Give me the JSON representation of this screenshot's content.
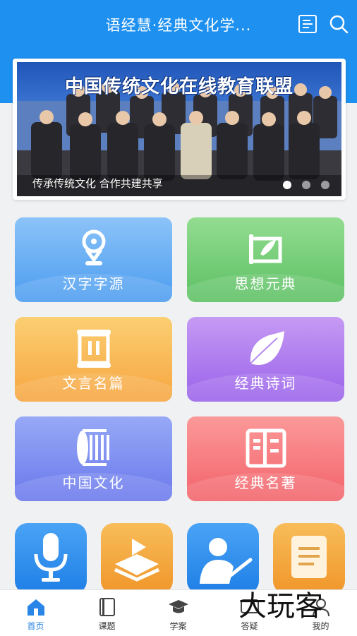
{
  "header": {
    "title": "语经慧·经典文化学...",
    "menu_icon": "list-icon",
    "search_icon": "search-icon"
  },
  "banner": {
    "headline": "中国传统文化在线教育联盟",
    "caption": "传承传统文化 合作共建共享",
    "active_slide": 1,
    "slide_count": 3
  },
  "tiles": [
    {
      "label": "汉字字源",
      "icon": "location-pin-icon",
      "color_top": "#8cc3f8",
      "color_bottom": "#4b9cf0"
    },
    {
      "label": "思想元典",
      "icon": "scroll-brush-icon",
      "color_top": "#93dc91",
      "color_bottom": "#5cc063"
    },
    {
      "label": "文言名篇",
      "icon": "scroll-frame-icon",
      "color_top": "#fbcf73",
      "color_bottom": "#f6a53f"
    },
    {
      "label": "经典诗词",
      "icon": "leaf-icon",
      "color_top": "#c59af3",
      "color_bottom": "#9a62ea"
    },
    {
      "label": "中国文化",
      "icon": "bamboo-scroll-icon",
      "color_top": "#97a9f6",
      "color_bottom": "#6a78ec"
    },
    {
      "label": "经典名著",
      "icon": "book-icon",
      "color_top": "#fb9999",
      "color_bottom": "#f2636a"
    }
  ],
  "apps": [
    {
      "icon": "microphone-icon",
      "color": "#2f8ff0"
    },
    {
      "icon": "video-book-icon",
      "color": "#f5a53a"
    },
    {
      "icon": "teacher-icon",
      "color": "#2f8ff0"
    },
    {
      "icon": "notes-icon",
      "color": "#f5a53a"
    }
  ],
  "tabs": [
    {
      "label": "首页",
      "icon": "home-icon",
      "active": true
    },
    {
      "label": "课题",
      "icon": "book-icon",
      "active": false
    },
    {
      "label": "学案",
      "icon": "graduation-cap-icon",
      "active": false
    },
    {
      "label": "答疑",
      "icon": "question-icon",
      "active": false
    },
    {
      "label": "我的",
      "icon": "user-icon",
      "active": false
    }
  ],
  "watermark": "大玩客",
  "colors": {
    "header": "#1e90f0",
    "accent": "#2a86e6"
  }
}
